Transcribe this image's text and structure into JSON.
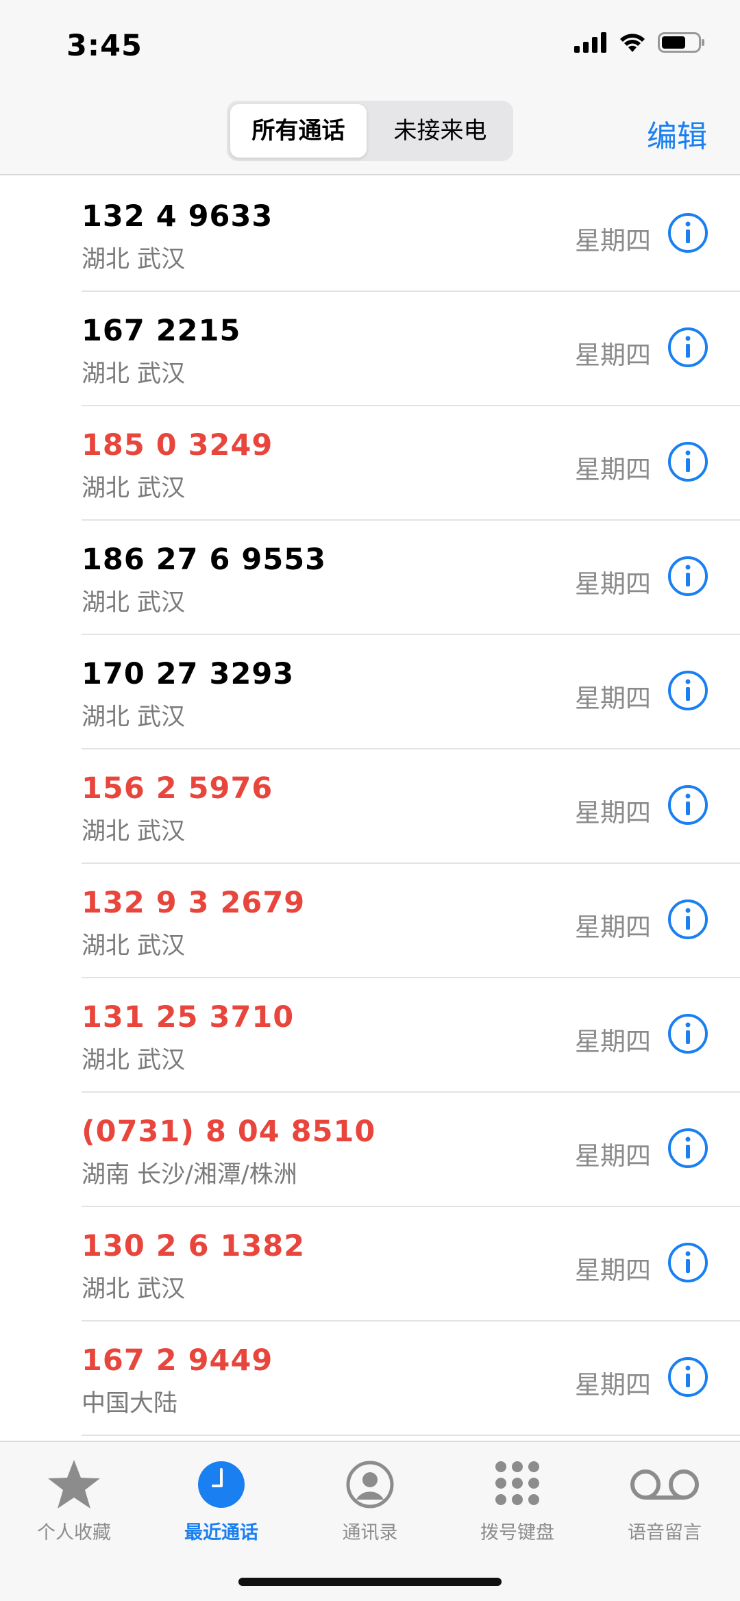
{
  "status_bar": {
    "time": "3:45",
    "icons": [
      "cellular-signal-icon",
      "wifi-icon",
      "battery-icon"
    ]
  },
  "header": {
    "segments": [
      {
        "label": "所有通话",
        "selected": true
      },
      {
        "label": "未接来电",
        "selected": false
      }
    ],
    "edit_label": "编辑"
  },
  "calls": [
    {
      "number": "132 4 9633",
      "location": "湖北 武汉",
      "day": "星期四",
      "missed": false
    },
    {
      "number": "167 2215",
      "location": "湖北 武汉",
      "day": "星期四",
      "missed": false
    },
    {
      "number": "185 0 3249",
      "location": "湖北 武汉",
      "day": "星期四",
      "missed": true
    },
    {
      "number": "186 27 6 9553",
      "location": "湖北 武汉",
      "day": "星期四",
      "missed": false
    },
    {
      "number": "170 27 3293",
      "location": "湖北 武汉",
      "day": "星期四",
      "missed": false
    },
    {
      "number": "156 2 5976",
      "location": "湖北 武汉",
      "day": "星期四",
      "missed": true
    },
    {
      "number": "132 9 3 2679",
      "location": "湖北 武汉",
      "day": "星期四",
      "missed": true
    },
    {
      "number": "131 25 3710",
      "location": "湖北 武汉",
      "day": "星期四",
      "missed": true
    },
    {
      "number": "(0731) 8 04 8510",
      "location": "湖南 长沙/湘潭/株洲",
      "day": "星期四",
      "missed": true
    },
    {
      "number": "130 2 6 1382",
      "location": "湖北 武汉",
      "day": "星期四",
      "missed": true
    },
    {
      "number": "167 2 9449",
      "location": "中国大陆",
      "day": "星期四",
      "missed": true
    }
  ],
  "tabbar": {
    "tabs": [
      {
        "label": "个人收藏",
        "icon": "star-icon",
        "active": false
      },
      {
        "label": "最近通话",
        "icon": "clock-icon",
        "active": true
      },
      {
        "label": "通讯录",
        "icon": "contact-icon",
        "active": false
      },
      {
        "label": "拨号键盘",
        "icon": "keypad-icon",
        "active": false
      },
      {
        "label": "语音留言",
        "icon": "voicemail-icon",
        "active": false
      }
    ]
  },
  "colors": {
    "accent": "#1a7ff0",
    "missed": "#e8453c",
    "secondary_text": "#7a7a7a"
  }
}
